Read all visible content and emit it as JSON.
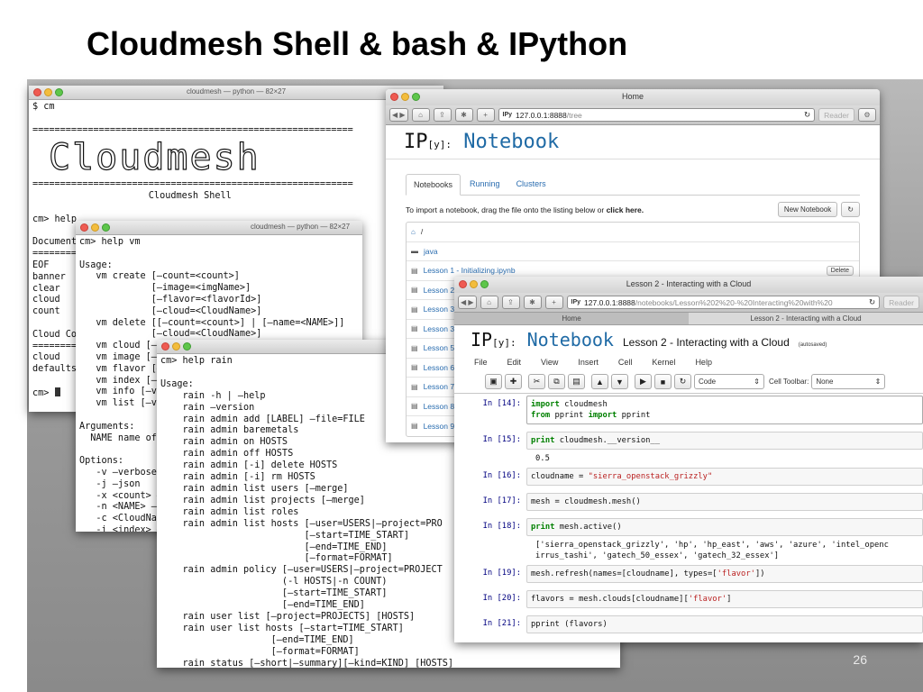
{
  "slide": {
    "title": "Cloudmesh Shell & bash & IPython",
    "page_number": "26"
  },
  "term1": {
    "title": "cloudmesh — python — 82×27",
    "lines_top": "$ cm\n\n==========================================================",
    "logo_text": "Cloudmesh",
    "lines_bottom": "==========================================================\n                     Cloudmesh Shell\n\ncm> help\n\nDocumente\n==========\nEOF     c\nbanner  c\nclear   c\ncloud   c\ncount   c\n\nCloud Com\n==========\ncloud\ndefaults\n\ncm> "
  },
  "term2": {
    "title": "cloudmesh — python — 82×27",
    "lines": "cm> help vm\n\nUsage:\n   vm create [—count=<count>]\n             [—image=<imgName>]\n             [—flavor=<flavorId>]\n             [—cloud=<CloudName>]\n   vm delete [[—count=<count>] | [—name=<NAME>]]\n             [—cloud=<CloudName>]\n   vm cloud [—name=<NAME>]\n   vm image [—n\n   vm flavor [—\n   vm index [—i\n   vm info [—ve\n   vm list [—ve\n\nArguments:\n  NAME name of\n\nOptions:\n   -v —verbose\n   -j —json\n   -x <count> —\n   -n <NAME> —\n   -c <CloudNam\n   -i <index> —\n   —img=<imgNa"
  },
  "term3": {
    "title": "cloudmesh",
    "lines": "cm> help rain\n\nUsage:\n    rain -h | —help\n    rain —version\n    rain admin add [LABEL] —file=FILE\n    rain admin baremetals\n    rain admin on HOSTS\n    rain admin off HOSTS\n    rain admin [-i] delete HOSTS\n    rain admin [-i] rm HOSTS\n    rain admin list users [—merge]\n    rain admin list projects [—merge]\n    rain admin list roles\n    rain admin list hosts [—user=USERS|—project=PRO\n                          [—start=TIME_START]\n                          [—end=TIME_END]\n                          [—format=FORMAT]\n    rain admin policy [—user=USERS|—project=PROJECT\n                      (-l HOSTS|-n COUNT)\n                      [—start=TIME_START]\n                      [—end=TIME_END]\n    rain user list [—project=PROJECTS] [HOSTS]\n    rain user list hosts [—start=TIME_START]\n                    [—end=TIME_END]\n                    [—format=FORMAT]\n    rain status [—short|—summary][—kind=KIND] [HOSTS]"
  },
  "browser1": {
    "title": "Home",
    "url_host": "127.0.0.1:8888",
    "url_path": "/tree",
    "reader_label": "Reader",
    "logo_ip": "IP",
    "logo_y": "[y]:",
    "logo_nb": "Notebook",
    "tabs": [
      {
        "label": "Notebooks"
      },
      {
        "label": "Running"
      },
      {
        "label": "Clusters"
      }
    ],
    "import_text": "To import a notebook, drag the file onto the listing below or ",
    "import_link": "click here.",
    "new_notebook_label": "New Notebook",
    "breadcrumb": "/",
    "files": [
      {
        "name": "java"
      },
      {
        "name": "Lesson 1 - Initializing.ipynb",
        "delete": "Delete"
      },
      {
        "name": "Lesson 2"
      },
      {
        "name": "Lesson 3"
      },
      {
        "name": "Lesson 3"
      },
      {
        "name": "Lesson 5"
      },
      {
        "name": "Lesson 6"
      },
      {
        "name": "Lesson 7"
      },
      {
        "name": "Lesson 8"
      },
      {
        "name": "Lesson 9"
      }
    ]
  },
  "browser2": {
    "title": "Lesson 2 - Interacting with a Cloud",
    "url_host": "127.0.0.1:8888",
    "url_path": "/notebooks/Lesson%202%20-%20Interacting%20with%20",
    "reader_label": "Reader",
    "tab_home": "Home",
    "tab_lesson": "Lesson 2 - Interacting with a Cloud",
    "logo_ip": "IP",
    "logo_y": "[y]:",
    "logo_nb": "Notebook",
    "notebook_name": "Lesson 2 - Interacting with a Cloud",
    "autosave": "(autosaved)",
    "menu": [
      "File",
      "Edit",
      "View",
      "Insert",
      "Cell",
      "Kernel",
      "Help"
    ],
    "cell_type": "Code",
    "cell_toolbar_label": "Cell Toolbar:",
    "cell_toolbar_value": "None",
    "cells": [
      {
        "prompt": "In [14]:",
        "kw1": "import",
        "code1": " cloudmesh",
        "kw2": "from",
        "code2": " pprint ",
        "kw3": "import",
        "code3": " pprint"
      },
      {
        "prompt": "In [15]:",
        "kw": "print",
        "code": " cloudmesh.__version__",
        "output": "0.5"
      },
      {
        "prompt": "In [16]:",
        "code": "cloudname = ",
        "str": "\"sierra_openstack_grizzly\""
      },
      {
        "prompt": "In [17]:",
        "code": "mesh = cloudmesh.mesh()"
      },
      {
        "prompt": "In [18]:",
        "kw": "print",
        "code": " mesh.active()",
        "output": "['sierra_openstack_grizzly', 'hp', 'hp_east', 'aws', 'azure', 'intel_openc\nirrus_tashi', 'gatech_50_essex', 'gatech_32_essex']"
      },
      {
        "prompt": "In [19]:",
        "code": "mesh.refresh(names=[cloudname], types=[",
        "str": "'flavor'",
        "code_end": "])"
      },
      {
        "prompt": "In [20]:",
        "code": "flavors = mesh.clouds[cloudname][",
        "str": "'flavor'",
        "code_end": "]"
      },
      {
        "prompt": "In [21]:",
        "code": "pprint (flavors)"
      }
    ]
  }
}
